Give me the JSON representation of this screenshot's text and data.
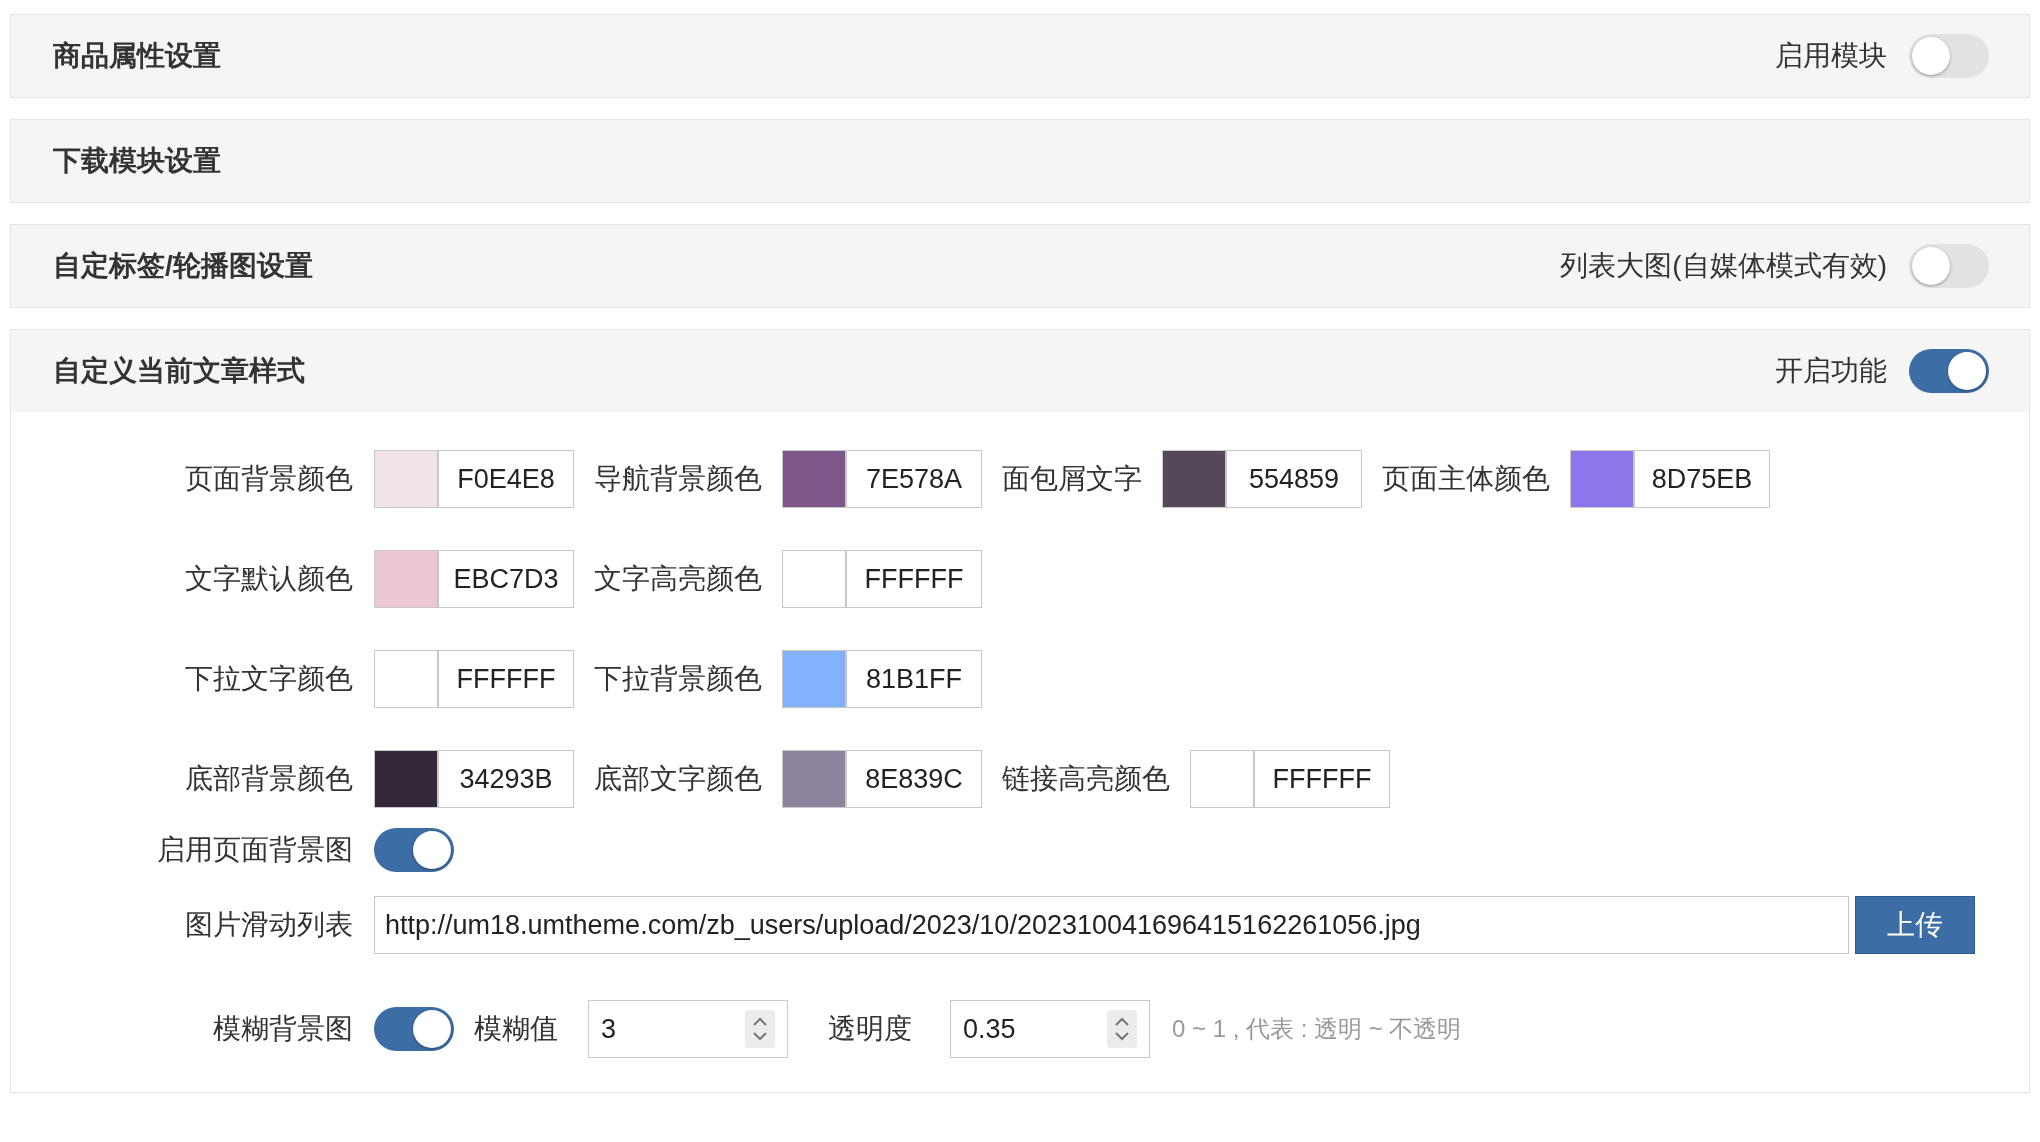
{
  "panels": [
    {
      "title": "商品属性设置",
      "toggle": {
        "label": "启用模块",
        "on": false
      }
    },
    {
      "title": "下载模块设置"
    },
    {
      "title": "自定标签/轮播图设置",
      "toggle": {
        "label": "列表大图(自媒体模式有效)",
        "on": false
      }
    },
    {
      "title": "自定义当前文章样式",
      "toggle": {
        "label": "开启功能",
        "on": true
      }
    }
  ],
  "style_settings": {
    "color_rows": [
      [
        {
          "label": "页面背景颜色",
          "value": "F0E4E8",
          "color": "#f0e4e8"
        },
        {
          "label": "导航背景颜色",
          "value": "7E578A",
          "color": "#7e578a"
        },
        {
          "label": "面包屑文字",
          "value": "554859",
          "color": "#554859"
        },
        {
          "label": "页面主体颜色",
          "value": "8D75EB",
          "color": "#8d75eb"
        }
      ],
      [
        {
          "label": "文字默认颜色",
          "value": "EBC7D3",
          "color": "#ebc7d3"
        },
        {
          "label": "文字高亮颜色",
          "value": "FFFFFF",
          "color": "#ffffff"
        }
      ],
      [
        {
          "label": "下拉文字颜色",
          "value": "FFFFFF",
          "color": "#ffffff"
        },
        {
          "label": "下拉背景颜色",
          "value": "81B1FF",
          "color": "#81b1ff"
        }
      ],
      [
        {
          "label": "底部背景颜色",
          "value": "34293B",
          "color": "#34293b"
        },
        {
          "label": "底部文字颜色",
          "value": "8E839C",
          "color": "#8e839c"
        },
        {
          "label": "链接高亮颜色",
          "value": "FFFFFF",
          "color": "#ffffff"
        }
      ]
    ],
    "background_image": {
      "label": "启用页面背景图",
      "on": true
    },
    "image_list": {
      "label": "图片滑动列表",
      "value": "http://um18.umtheme.com/zb_users/upload/2023/10/202310041696415162261056.jpg",
      "button": "上传"
    },
    "blur": {
      "label": "模糊背景图",
      "on": true,
      "blur_label": "模糊值",
      "blur_value": "3",
      "opacity_label": "透明度",
      "opacity_value": "0.35",
      "hint": "0 ~ 1 , 代表 : 透明 ~ 不透明"
    }
  }
}
